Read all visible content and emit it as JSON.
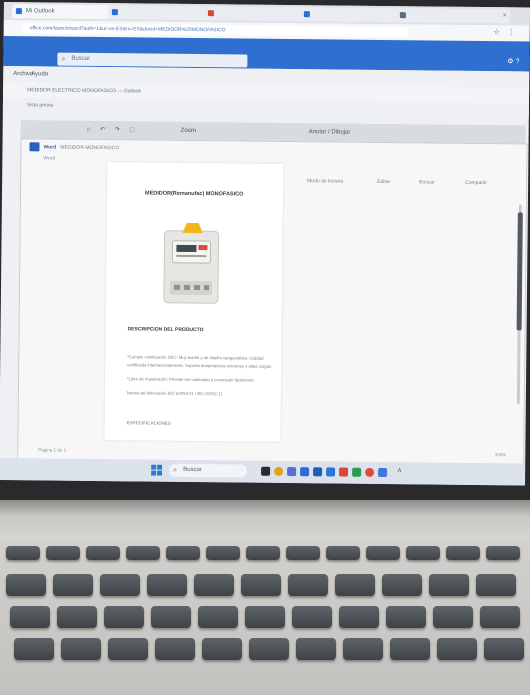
{
  "browser": {
    "tabs": [
      {
        "label": "Mi Outlook",
        "favicon_color": "#2b6cd6"
      },
      {
        "label": "",
        "favicon_color": "#2b6cd6"
      },
      {
        "label": "",
        "favicon_color": "#d9463a"
      },
      {
        "label": "",
        "favicon_color": "#2b6cd6"
      },
      {
        "label": "",
        "favicon_color": "#5f6b7a"
      }
    ],
    "address": "office.com/launch/word?auth=1&ui=es-ES&rs=ES&docid=MEDIDOR%20MONOFASICO",
    "address_actions": "☆ ⋮"
  },
  "office": {
    "search_placeholder": "Buscar",
    "header_right": "⚙ ?"
  },
  "menu": {
    "archivo": "Archivo",
    "ayuda": "Ayuda"
  },
  "outlook": {
    "folder_line": "MEDIDOR ELECTRICO MONOFASICO — Outlook",
    "view_line": "Vista previa"
  },
  "ribbon": {
    "zoom": "Zoom",
    "annotate": "Anotar / Dibujar",
    "tools": "⌂ ↶ ↷ ⬚"
  },
  "viewer": {
    "app": "Word",
    "title": "MEDIDOR MONOFASICO",
    "subtitle": "Word",
    "actions": [
      "Modo de lectura",
      "Editar",
      "Buscar",
      "Compartir"
    ]
  },
  "document": {
    "title": "MEDIDOR(Remanufac) MONOFASICO",
    "section": "DESCRIPCION DEL PRODUCTO",
    "lines": [
      "*Cumple certificación SEC: Muy bonito y de diseño vanguardista. Calidad",
      "certificada internacionalmente. Soporta temperaturas extremas y altas cargas.",
      "*Libre de mantención: Permite ser cambiado y conectado fácilmente.",
      "Norma de fabricación IEC 62053-21 / IEC 62052-11"
    ],
    "next_heading": "ESPECIFICACIONES"
  },
  "status": {
    "page": "Página 1 de 1",
    "right": "100%"
  },
  "taskbar": {
    "search": "Buscar",
    "icons": [
      "#2b2b2b",
      "#e0a21b",
      "#5b6cd8",
      "#2b6cd6",
      "#1f5db8",
      "#2a78d6",
      "#d9463a",
      "#2d9b4f",
      "#e24a3b",
      "#3f7ad8"
    ]
  },
  "product_photo": {
    "body_color": "#e7e6e1",
    "cap_color": "#f2b51c",
    "display_color": "#3f4a4e",
    "label_color": "#d94b3e"
  }
}
